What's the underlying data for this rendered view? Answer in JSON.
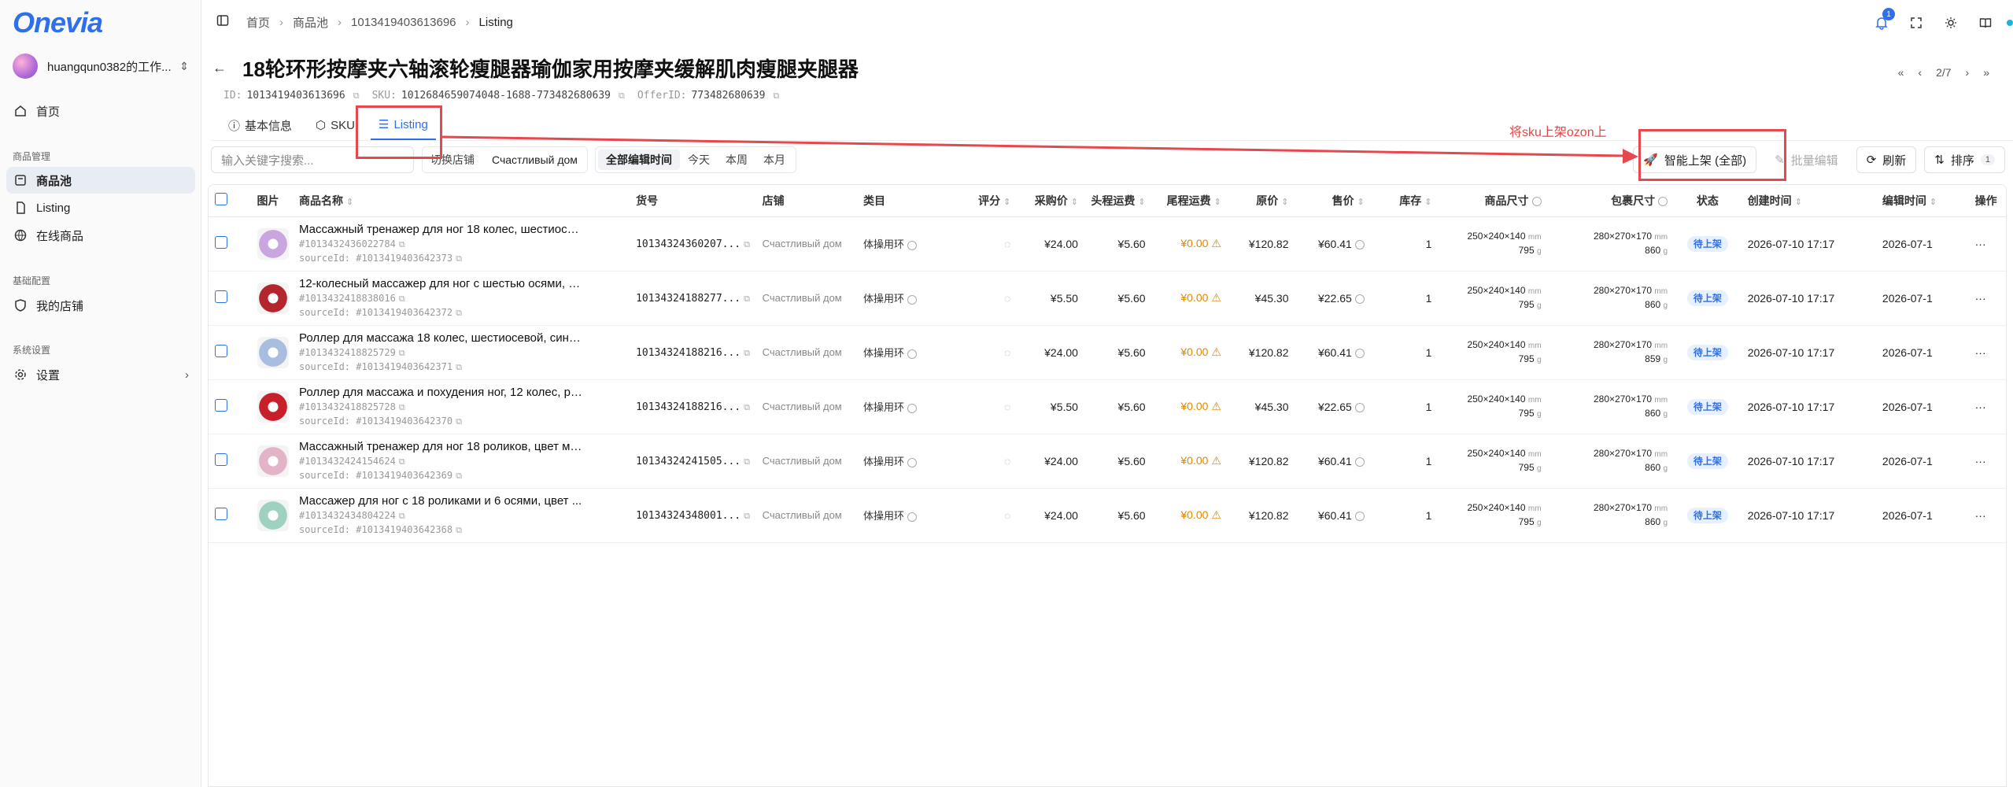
{
  "app": {
    "logo": "Onevia"
  },
  "workspace": {
    "name": "huangqun0382的工作..."
  },
  "sidebar": {
    "home": "首页",
    "section_goods": "商品管理",
    "items": [
      "商品池",
      "Listing",
      "在线商品"
    ],
    "section_base": "基础配置",
    "my_shop": "我的店铺",
    "section_sys": "系统设置",
    "settings": "设置"
  },
  "breadcrumb": [
    "首页",
    "商品池",
    "1013419403613696",
    "Listing"
  ],
  "notifications": {
    "count": "1"
  },
  "page": {
    "title": "18轮环形按摩夹六轴滚轮瘦腿器瑜伽家用按摩夹缓解肌肉瘦腿夹腿器",
    "id_label": "ID:",
    "id": "1013419403613696",
    "sku_label": "SKU:",
    "sku": "1012684659074048-1688-773482680639",
    "offer_label": "OfferID:",
    "offer": "773482680639",
    "pager": "2/7"
  },
  "tabs": [
    "基本信息",
    "SKU",
    "Listing"
  ],
  "toolbar": {
    "search_placeholder": "输入关键字搜索...",
    "shop_label": "切换店铺",
    "shop_value": "Счастливый дом",
    "time_options": [
      "全部编辑时间",
      "今天",
      "本周",
      "本月"
    ],
    "smart_list": "智能上架 (全部)",
    "batch_edit": "批量编辑",
    "refresh": "刷新",
    "sort": "排序",
    "sort_count": "1"
  },
  "annotation": {
    "text": "将sku上架ozon上"
  },
  "table": {
    "headers": [
      "图片",
      "商品名称",
      "货号",
      "店铺",
      "类目",
      "评分",
      "采购价",
      "头程运费",
      "尾程运费",
      "原价",
      "售价",
      "库存",
      "商品尺寸",
      "包裹尺寸",
      "状态",
      "创建时间",
      "编辑时间",
      "操作"
    ],
    "rows": [
      {
        "name": "Массажный тренажер для ног 18 колес, шестиосе...",
        "id": "#1013432436022784",
        "source": "sourceId: #1013419403642373",
        "sku": "10134324360207...",
        "shop": "Счастливый дом",
        "cat": "体操用环",
        "buy": "¥24.00",
        "first": "¥5.60",
        "last": "¥0.00",
        "orig": "¥120.82",
        "sale": "¥60.41",
        "stock": "1",
        "psize": "250×240×140",
        "pweight": "795",
        "bsize": "280×270×170",
        "bweight": "860",
        "status": "待上架",
        "created": "2026-07-10 17:17",
        "edited": "2026-07-1",
        "img": "#c9a6e0"
      },
      {
        "name": "12-колесный массажер для ног с шестью осями, с...",
        "id": "#1013432418838016",
        "source": "sourceId: #1013419403642372",
        "sku": "10134324188277...",
        "shop": "Счастливый дом",
        "cat": "体操用环",
        "buy": "¥5.50",
        "first": "¥5.60",
        "last": "¥0.00",
        "orig": "¥45.30",
        "sale": "¥22.65",
        "stock": "1",
        "psize": "250×240×140",
        "pweight": "795",
        "bsize": "280×270×170",
        "bweight": "860",
        "status": "待上架",
        "created": "2026-07-10 17:17",
        "edited": "2026-07-1",
        "img": "#b3262e"
      },
      {
        "name": "Роллер для массажа 18 колес, шестиосевой, сини...",
        "id": "#1013432418825729",
        "source": "sourceId: #1013419403642371",
        "sku": "10134324188216...",
        "shop": "Счастливый дом",
        "cat": "体操用环",
        "buy": "¥24.00",
        "first": "¥5.60",
        "last": "¥0.00",
        "orig": "¥120.82",
        "sale": "¥60.41",
        "stock": "1",
        "psize": "250×240×140",
        "pweight": "795",
        "bsize": "280×270×170",
        "bweight": "859",
        "status": "待上架",
        "created": "2026-07-10 17:17",
        "edited": "2026-07-1",
        "img": "#a9bde0"
      },
      {
        "name": "Роллер для массажа и похудения ног, 12 колес, ро...",
        "id": "#1013432418825728",
        "source": "sourceId: #1013419403642370",
        "sku": "10134324188216...",
        "shop": "Счастливый дом",
        "cat": "体操用环",
        "buy": "¥5.50",
        "first": "¥5.60",
        "last": "¥0.00",
        "orig": "¥45.30",
        "sale": "¥22.65",
        "stock": "1",
        "psize": "250×240×140",
        "pweight": "795",
        "bsize": "280×270×170",
        "bweight": "860",
        "status": "待上架",
        "created": "2026-07-10 17:17",
        "edited": "2026-07-1",
        "img": "#c8202a"
      },
      {
        "name": "Массажный тренажер для ног 18 роликов, цвет мо...",
        "id": "#1013432424154624",
        "source": "sourceId: #1013419403642369",
        "sku": "10134324241505...",
        "shop": "Счастливый дом",
        "cat": "体操用环",
        "buy": "¥24.00",
        "first": "¥5.60",
        "last": "¥0.00",
        "orig": "¥120.82",
        "sale": "¥60.41",
        "stock": "1",
        "psize": "250×240×140",
        "pweight": "795",
        "bsize": "280×270×170",
        "bweight": "860",
        "status": "待上架",
        "created": "2026-07-10 17:17",
        "edited": "2026-07-1",
        "img": "#e3b3c8"
      },
      {
        "name": "Массажер для ног с 18 роликами и 6 осями, цвет ...",
        "id": "#1013432434804224",
        "source": "sourceId: #1013419403642368",
        "sku": "10134324348001...",
        "shop": "Счастливый дом",
        "cat": "体操用环",
        "buy": "¥24.00",
        "first": "¥5.60",
        "last": "¥0.00",
        "orig": "¥120.82",
        "sale": "¥60.41",
        "stock": "1",
        "psize": "250×240×140",
        "pweight": "795",
        "bsize": "280×270×170",
        "bweight": "860",
        "status": "待上架",
        "created": "2026-07-10 17:17",
        "edited": "2026-07-1",
        "img": "#9fd1c0"
      }
    ],
    "units": {
      "mm": "mm",
      "g": "g"
    }
  }
}
